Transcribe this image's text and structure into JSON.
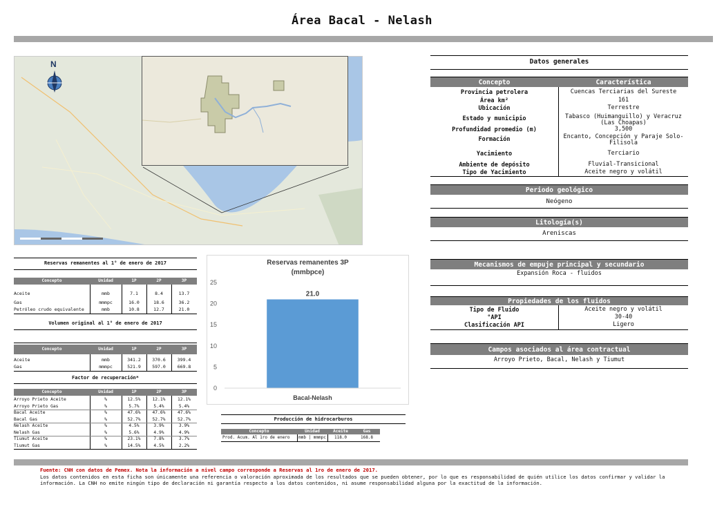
{
  "title": "Área Bacal - Nelash",
  "map": {
    "north_label": "N"
  },
  "general": {
    "title": "Datos generales",
    "col_concepto": "Concepto",
    "col_caracteristica": "Característica",
    "rows": [
      {
        "k": "Provincia petrolera",
        "v": "Cuencas Terciarias del Sureste"
      },
      {
        "k": "Área km²",
        "v": "161"
      },
      {
        "k": "Ubicación",
        "v": "Terrestre"
      },
      {
        "k": "Estado y municipio",
        "v": "Tabasco (Huimanguillo) y Veracruz (Las Choapas)"
      },
      {
        "k": "Profundidad promedio (m)",
        "v": "3,500"
      },
      {
        "k": "Formación",
        "v": "Encanto, Concepción y Paraje Solo-Filisola"
      },
      {
        "k": "Yacimiento",
        "v": "Terciario"
      },
      {
        "k": "Ambiente de depósito",
        "v": "Fluvial-Transicional"
      },
      {
        "k": "Tipo de Yacimiento",
        "v": "Aceite negro y volátil"
      }
    ]
  },
  "periodo": {
    "title": "Periodo geológico",
    "value": "Neógeno"
  },
  "litologia": {
    "title": "Litología(s)",
    "value": "Areniscas"
  },
  "mecanismos": {
    "title": "Mecanismos de empuje principal y secundario",
    "value": "Expansión Roca - fluidos"
  },
  "propiedades": {
    "title": "Propiedades de los fluidos",
    "rows": [
      {
        "k": "Tipo de Fluido",
        "v": "Aceite negro y volátil"
      },
      {
        "k": "°API",
        "v": "30-40"
      },
      {
        "k": "Clasificación API",
        "v": "Ligero"
      }
    ]
  },
  "campos": {
    "title": "Campos asociados al área contractual",
    "value": "Arroyo Prieto, Bacal, Nelash y Tiumut"
  },
  "reservas": {
    "title": "Reservas remanentes al 1° de enero de 2017",
    "headers": [
      "Concepto",
      "Unidad",
      "1P",
      "2P",
      "3P"
    ],
    "rows": [
      [
        "Aceite",
        "mmb",
        "7.1",
        "8.4",
        "13.7"
      ],
      [
        "Gas",
        "mmmpc",
        "16.0",
        "18.6",
        "36.2"
      ],
      [
        "Petróleo crudo equivalente",
        "mmb",
        "10.8",
        "12.7",
        "21.0"
      ]
    ]
  },
  "volumen": {
    "title": "Volumen original al 1° de enero de 2017",
    "headers": [
      "Concepto",
      "Unidad",
      "1P",
      "2P",
      "3P"
    ],
    "rows": [
      [
        "Aceite",
        "mmb",
        "341.2",
        "370.6",
        "399.4"
      ],
      [
        "Gas",
        "mmmpc",
        "521.9",
        "597.0",
        "669.8"
      ]
    ]
  },
  "factor": {
    "title": "Factor de recuperación*",
    "headers": [
      "Concepto",
      "Unidad",
      "1P",
      "2P",
      "3P"
    ],
    "rows": [
      [
        "Arroyo Prieto Aceite",
        "%",
        "12.5%",
        "12.1%",
        "12.1%"
      ],
      [
        "Arroyo Prieto Gas",
        "%",
        "5.7%",
        "5.4%",
        "5.4%"
      ],
      [
        "Bacal Aceite",
        "%",
        "47.6%",
        "47.6%",
        "47.6%"
      ],
      [
        "Bacal Gas",
        "%",
        "52.7%",
        "52.7%",
        "52.7%"
      ],
      [
        "Nelash Aceite",
        "%",
        "4.5%",
        "3.9%",
        "3.9%"
      ],
      [
        "Nelash Gas",
        "%",
        "5.6%",
        "4.9%",
        "4.9%"
      ],
      [
        "Tiumut Aceite",
        "%",
        "23.1%",
        "7.8%",
        "3.7%"
      ],
      [
        "Tiumut Gas",
        "%",
        "14.5%",
        "4.5%",
        "2.2%"
      ]
    ]
  },
  "produccion": {
    "title": "Producción de hidrocarburos",
    "headers": [
      "Concepto",
      "Unidad",
      "Aceite",
      "Gas"
    ],
    "row": [
      "Prod. Acum. Al 1ro de enero",
      "mmb | mmmpc",
      "118.0",
      "168.8"
    ]
  },
  "chart_data": {
    "type": "bar",
    "title": "Reservas remanentes 3P",
    "subtitle": "(mmbpce)",
    "categories": [
      "Bacal-Nelash"
    ],
    "values": [
      21.0
    ],
    "data_labels": [
      "21.0"
    ],
    "ylim": [
      0,
      25
    ],
    "yticks": [
      "0",
      "5",
      "10",
      "15",
      "20",
      "25"
    ],
    "grid": false,
    "bar_color": "#5b9bd5"
  },
  "footer": {
    "source": "Fuente: CNH con datos de Pemex. Nota la información a nivel campo corresponde a Reservas al 1ro de enero de 2017.",
    "disclaimer_line1": "Los datos contenidos en esta ficha son únicamente una referencia o valoración aproximada de los resultados que se pueden obtener, por lo que es responsabilidad de quién utilice los datos confirmar y validar la",
    "disclaimer_line2": "información. La CNH no emite ningún tipo de declaración ni garantía respecto a los datos contenidos, ni asume responsabilidad alguna por la exactitud de la información."
  },
  "colors": {
    "header_gray": "#7f7f7f",
    "band_gray": "#a7a7a7",
    "source_red": "#c00000"
  }
}
